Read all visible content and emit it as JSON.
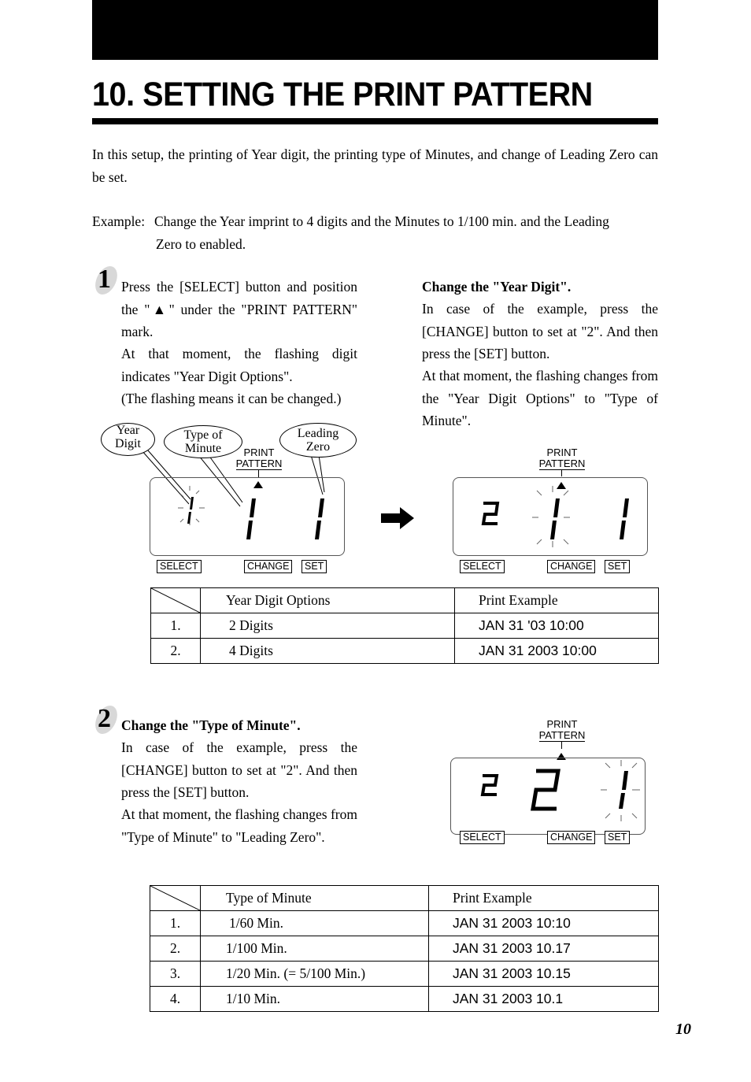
{
  "header": {
    "title": "10. SETTING THE PRINT PATTERN"
  },
  "intro": {
    "paragraph": "In this setup, the printing of Year digit, the printing type of Minutes, and change of Leading Zero can be set.",
    "example_label": "Example:",
    "example_line1": "Change the Year imprint to 4 digits and the Minutes to 1/100 min. and the Leading",
    "example_line2": "Zero to enabled."
  },
  "step1": {
    "number": "1",
    "left_text_1": "Press the [SELECT] button and position the \"▲\" under the \"PRINT PATTERN\" mark.",
    "left_text_2": "At that moment, the flashing digit indicates \"Year Digit Options\".",
    "left_text_3": "(The flashing means it can be changed.)",
    "right_heading": "Change the \"Year Digit\".",
    "right_text_1": "In case of the example, press the [CHANGE] button to set at \"2\". And then press the [SET] button.",
    "right_text_2": "At that moment, the flashing changes from the \"Year Digit Options\" to \"Type of Minute\".",
    "callouts": {
      "year_digit": [
        "Year",
        "Digit"
      ],
      "type_of_minute": [
        "Type of",
        "Minute"
      ],
      "leading_zero": [
        "Leading",
        "Zero"
      ]
    },
    "display_before": {
      "digits": [
        "1",
        "1",
        "1"
      ],
      "flashing_index": 0
    },
    "display_after": {
      "digits": [
        "2",
        "1",
        "1"
      ],
      "flashing_index": 1
    }
  },
  "step2": {
    "number": "2",
    "heading": "Change the \"Type of Minute\".",
    "text_1": "In case of the example, press the [CHANGE] button to set at \"2\". And then press the [SET] button.",
    "text_2": "At that moment, the flashing changes from \"Type of Minute\" to \"Leading Zero\".",
    "display": {
      "digits": [
        "2",
        "2",
        "1"
      ],
      "flashing_index": 2
    }
  },
  "lcd": {
    "print_pattern_line1": "PRINT",
    "print_pattern_line2": "PATTERN",
    "select_label": "SELECT",
    "change_label": "CHANGE",
    "set_label": "SET"
  },
  "year_table": {
    "headers": [
      "",
      "Year Digit Options",
      "Print Example"
    ],
    "rows": [
      {
        "num": "1.",
        "option": "2 Digits",
        "example": "JAN 31 '03 10:00"
      },
      {
        "num": "2.",
        "option": "4 Digits",
        "example": "JAN 31 2003 10:00"
      }
    ]
  },
  "minute_table": {
    "headers": [
      "",
      "Type of Minute",
      "Print Example"
    ],
    "rows": [
      {
        "num": "1.",
        "option": "1/60 Min.",
        "example": "JAN 31 2003 10:10"
      },
      {
        "num": "2.",
        "option": "1/100 Min.",
        "example": "JAN 31 2003 10.17"
      },
      {
        "num": "3.",
        "option": "1/20 Min. (= 5/100 Min.)",
        "example": "JAN 31 2003 10.15"
      },
      {
        "num": "4.",
        "option": "1/10 Min.",
        "example": "JAN 31 2003 10.1"
      }
    ]
  },
  "footer": {
    "page_number": "10"
  }
}
